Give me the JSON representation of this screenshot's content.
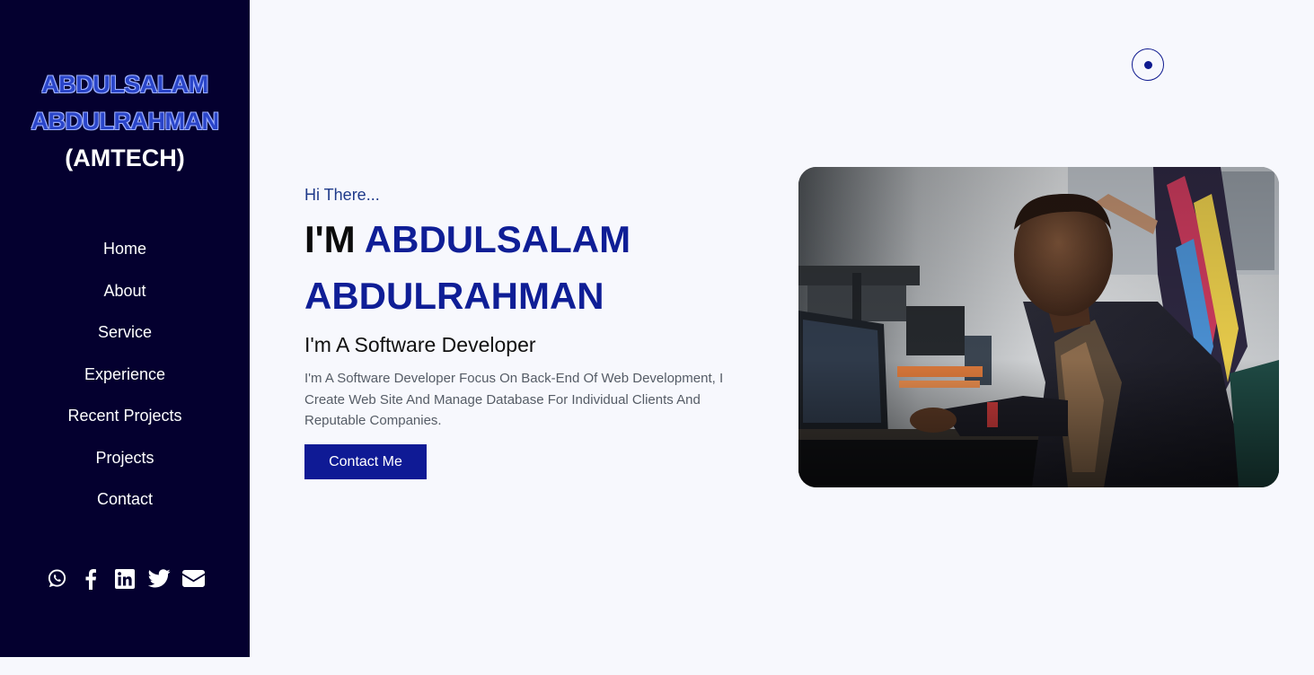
{
  "sidebar": {
    "brand": {
      "first_name": "ABDULSALAM",
      "last_name": "ABDULRAHMAN",
      "tag": "(AMTECH)"
    },
    "nav": [
      {
        "label": "Home"
      },
      {
        "label": "About"
      },
      {
        "label": "Service"
      },
      {
        "label": "Experience"
      },
      {
        "label": "Recent Projects"
      },
      {
        "label": "Projects"
      },
      {
        "label": "Contact"
      }
    ],
    "social": [
      {
        "icon": "whatsapp-icon"
      },
      {
        "icon": "facebook-icon"
      },
      {
        "icon": "linkedin-icon"
      },
      {
        "icon": "twitter-icon"
      },
      {
        "icon": "envelope-icon"
      }
    ]
  },
  "hero": {
    "greeting": "Hi There...",
    "headline_prefix": "I'M",
    "headline_name_1": "ABDULSALAM",
    "headline_name_2": "ABDULRAHMAN",
    "role": "I'm A Software Developer",
    "description": "I'm A Software Developer Focus On Back-End Of Web Development, I Create Web Site And Manage Database For Individual Clients And Reputable Companies.",
    "cta_label": "Contact Me"
  },
  "theme_toggle": {
    "icon": "theme-toggle-icon"
  },
  "photo": {
    "subject": "profile-photo"
  },
  "colors": {
    "sidebar_bg": "#04002f",
    "accent": "#0f1a95",
    "page_bg": "#f7f8fd"
  }
}
